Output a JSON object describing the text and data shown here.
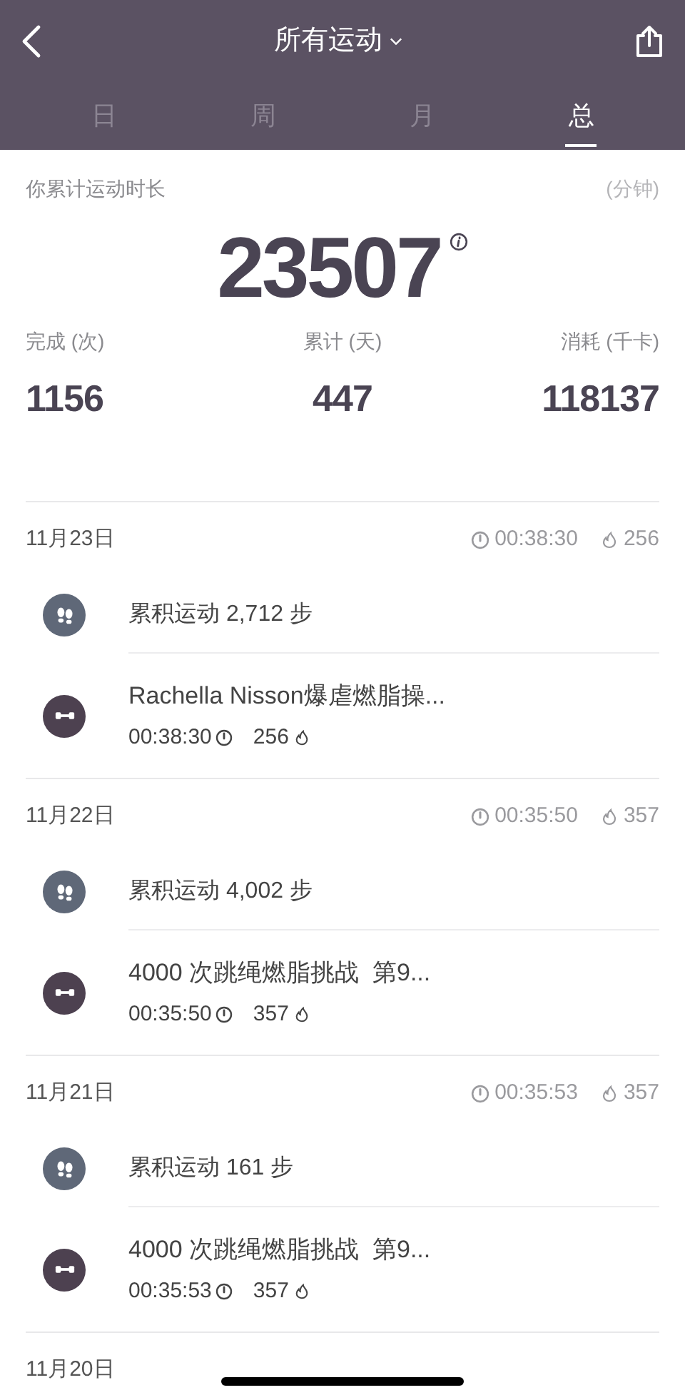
{
  "header": {
    "title": "所有运动"
  },
  "tabs": [
    {
      "label": "日",
      "selected": false
    },
    {
      "label": "周",
      "selected": false
    },
    {
      "label": "月",
      "selected": false
    },
    {
      "label": "总",
      "selected": true
    }
  ],
  "summary": {
    "label": "你累计运动时长",
    "unit": "(分钟)",
    "total": "23507",
    "stats": [
      {
        "label": "完成 (次)",
        "value": "1156"
      },
      {
        "label": "累计 (天)",
        "value": "447"
      },
      {
        "label": "消耗 (千卡)",
        "value": "118137"
      }
    ]
  },
  "days": [
    {
      "date": "11月23日",
      "duration": "00:38:30",
      "calories": "256",
      "items": [
        {
          "kind": "steps",
          "text": "累积运动 2,712 步"
        },
        {
          "kind": "workout",
          "title": "Rachella Nisson爆虐燃脂操...",
          "duration": "00:38:30",
          "calories": "256"
        }
      ]
    },
    {
      "date": "11月22日",
      "duration": "00:35:50",
      "calories": "357",
      "items": [
        {
          "kind": "steps",
          "text": "累积运动 4,002 步"
        },
        {
          "kind": "workout",
          "title": "4000 次跳绳燃脂挑战  第9...",
          "duration": "00:35:50",
          "calories": "357"
        }
      ]
    },
    {
      "date": "11月21日",
      "duration": "00:35:53",
      "calories": "357",
      "items": [
        {
          "kind": "steps",
          "text": "累积运动 161 步"
        },
        {
          "kind": "workout",
          "title": "4000 次跳绳燃脂挑战  第9...",
          "duration": "00:35:53",
          "calories": "357"
        }
      ]
    },
    {
      "date": "11月20日"
    }
  ]
}
